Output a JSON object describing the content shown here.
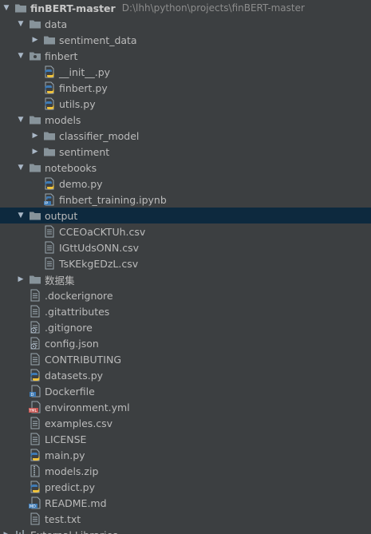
{
  "project": {
    "name": "finBERT-master",
    "path": "D:\\lhh\\python\\projects\\finBERT-master"
  },
  "tree": [
    {
      "label": "finBERT-master",
      "depth": 0,
      "type": "folder",
      "expanded": true,
      "is_root": true
    },
    {
      "label": "data",
      "depth": 1,
      "type": "folder",
      "expanded": true
    },
    {
      "label": "sentiment_data",
      "depth": 2,
      "type": "folder",
      "expanded": false
    },
    {
      "label": "finbert",
      "depth": 1,
      "type": "package",
      "expanded": true
    },
    {
      "label": "__init__.py",
      "depth": 2,
      "type": "python",
      "leaf": true
    },
    {
      "label": "finbert.py",
      "depth": 2,
      "type": "python",
      "leaf": true
    },
    {
      "label": "utils.py",
      "depth": 2,
      "type": "python",
      "leaf": true
    },
    {
      "label": "models",
      "depth": 1,
      "type": "folder",
      "expanded": true
    },
    {
      "label": "classifier_model",
      "depth": 2,
      "type": "folder",
      "expanded": false
    },
    {
      "label": "sentiment",
      "depth": 2,
      "type": "folder",
      "expanded": false
    },
    {
      "label": "notebooks",
      "depth": 1,
      "type": "folder",
      "expanded": true
    },
    {
      "label": "demo.py",
      "depth": 2,
      "type": "python",
      "leaf": true
    },
    {
      "label": "finbert_training.ipynb",
      "depth": 2,
      "type": "notebook",
      "leaf": true
    },
    {
      "label": "output",
      "depth": 1,
      "type": "folder",
      "expanded": true,
      "selected": true
    },
    {
      "label": "CCEOaCKTUh.csv",
      "depth": 2,
      "type": "text",
      "leaf": true
    },
    {
      "label": "IGttUdsONN.csv",
      "depth": 2,
      "type": "text",
      "leaf": true
    },
    {
      "label": "TsKEkgEDzL.csv",
      "depth": 2,
      "type": "text",
      "leaf": true
    },
    {
      "label": "数据集",
      "depth": 1,
      "type": "folder",
      "expanded": false
    },
    {
      "label": ".dockerignore",
      "depth": 1,
      "type": "text",
      "leaf": true
    },
    {
      "label": ".gitattributes",
      "depth": 1,
      "type": "text",
      "leaf": true
    },
    {
      "label": ".gitignore",
      "depth": 1,
      "type": "config",
      "leaf": true
    },
    {
      "label": "config.json",
      "depth": 1,
      "type": "config",
      "leaf": true
    },
    {
      "label": "CONTRIBUTING",
      "depth": 1,
      "type": "text",
      "leaf": true
    },
    {
      "label": "datasets.py",
      "depth": 1,
      "type": "python",
      "leaf": true
    },
    {
      "label": "Dockerfile",
      "depth": 1,
      "type": "docker",
      "leaf": true
    },
    {
      "label": "environment.yml",
      "depth": 1,
      "type": "yaml",
      "leaf": true
    },
    {
      "label": "examples.csv",
      "depth": 1,
      "type": "text",
      "leaf": true
    },
    {
      "label": "LICENSE",
      "depth": 1,
      "type": "text",
      "leaf": true
    },
    {
      "label": "main.py",
      "depth": 1,
      "type": "python",
      "leaf": true
    },
    {
      "label": "models.zip",
      "depth": 1,
      "type": "zip",
      "leaf": true
    },
    {
      "label": "predict.py",
      "depth": 1,
      "type": "python",
      "leaf": true
    },
    {
      "label": "README.md",
      "depth": 1,
      "type": "markdown",
      "leaf": true
    },
    {
      "label": "test.txt",
      "depth": 1,
      "type": "text",
      "leaf": true
    },
    {
      "label": "External Libraries",
      "depth": 0,
      "type": "libraries",
      "expanded": false
    }
  ],
  "colors": {
    "background": "#3c3f41",
    "selection": "#0d293e",
    "folder": "#87939a",
    "python_blue": "#3e7bb6",
    "python_yellow": "#f0c33c",
    "file": "#9aa7b0"
  }
}
